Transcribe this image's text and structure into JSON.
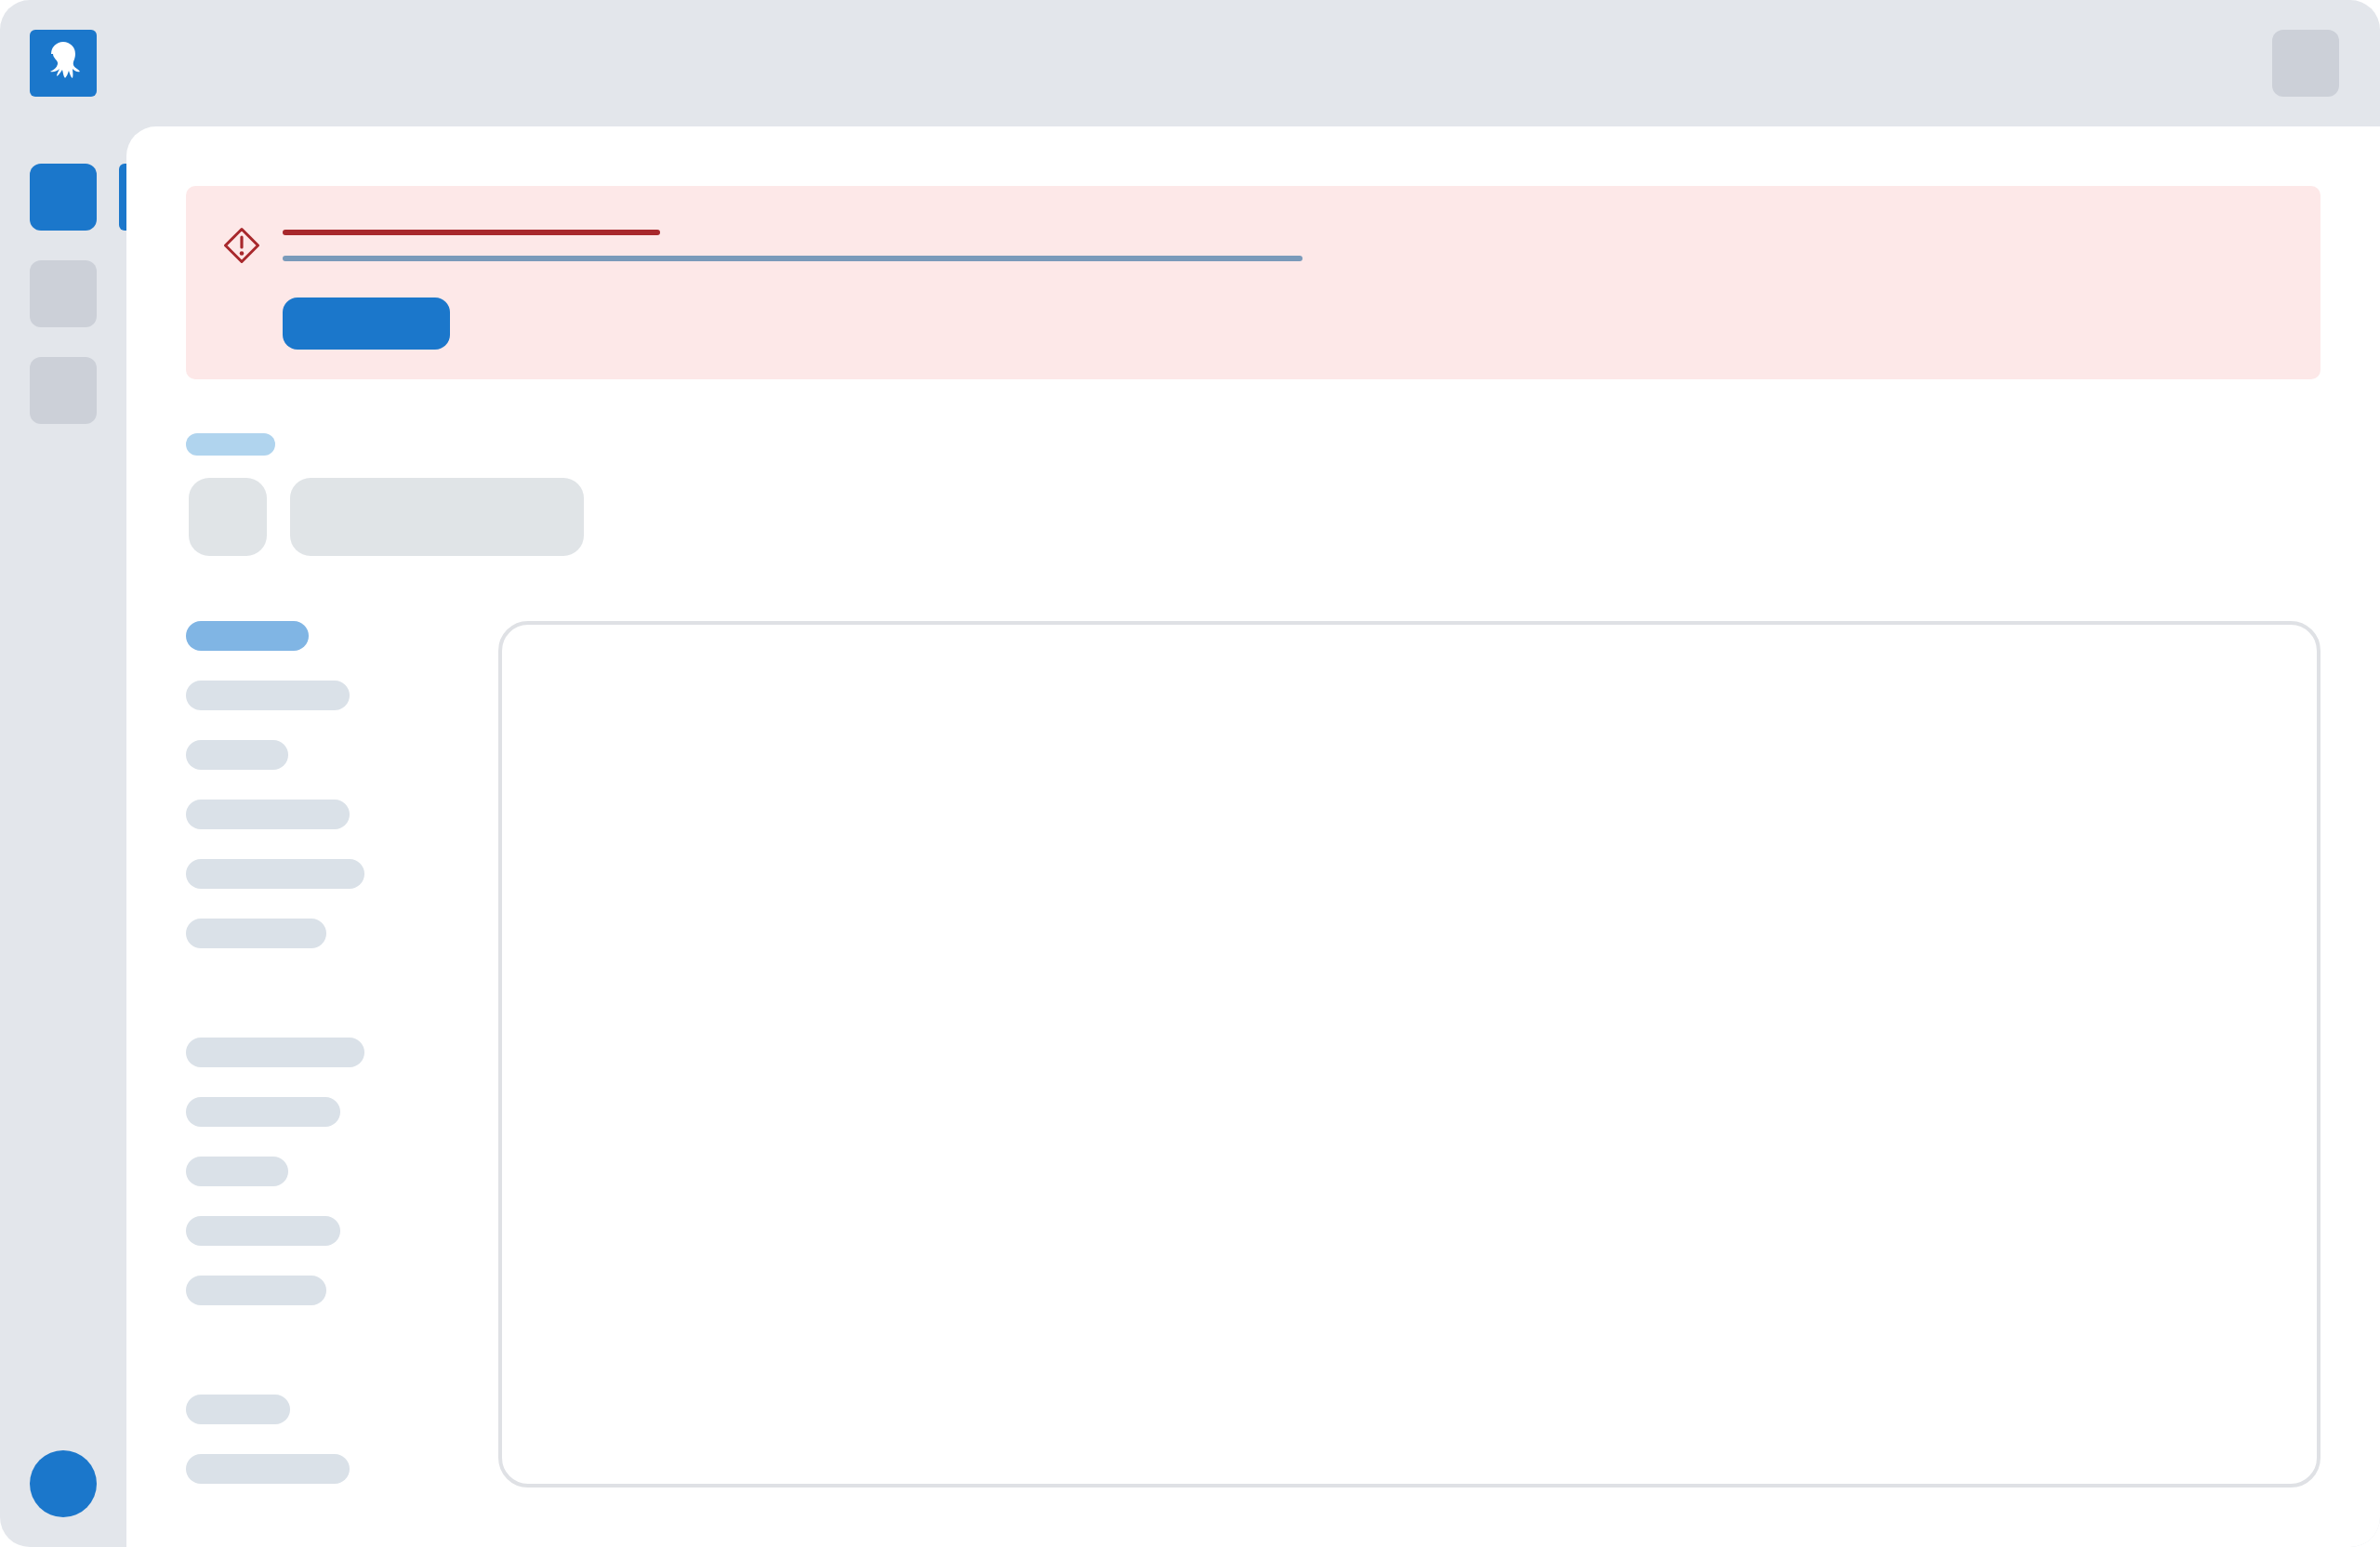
{
  "sidebar": {
    "items": [
      {
        "selected": true
      },
      {
        "selected": false
      },
      {
        "selected": false
      }
    ]
  },
  "side_nav": {
    "groups": [
      {
        "items": [
          {
            "selected": true
          },
          {
            "selected": false
          },
          {
            "selected": false
          },
          {
            "selected": false
          },
          {
            "selected": false
          },
          {
            "selected": false
          }
        ]
      },
      {
        "items": [
          {
            "selected": false
          },
          {
            "selected": false
          },
          {
            "selected": false
          },
          {
            "selected": false
          },
          {
            "selected": false
          }
        ]
      },
      {
        "items": [
          {
            "selected": false
          },
          {
            "selected": false
          }
        ]
      }
    ]
  }
}
